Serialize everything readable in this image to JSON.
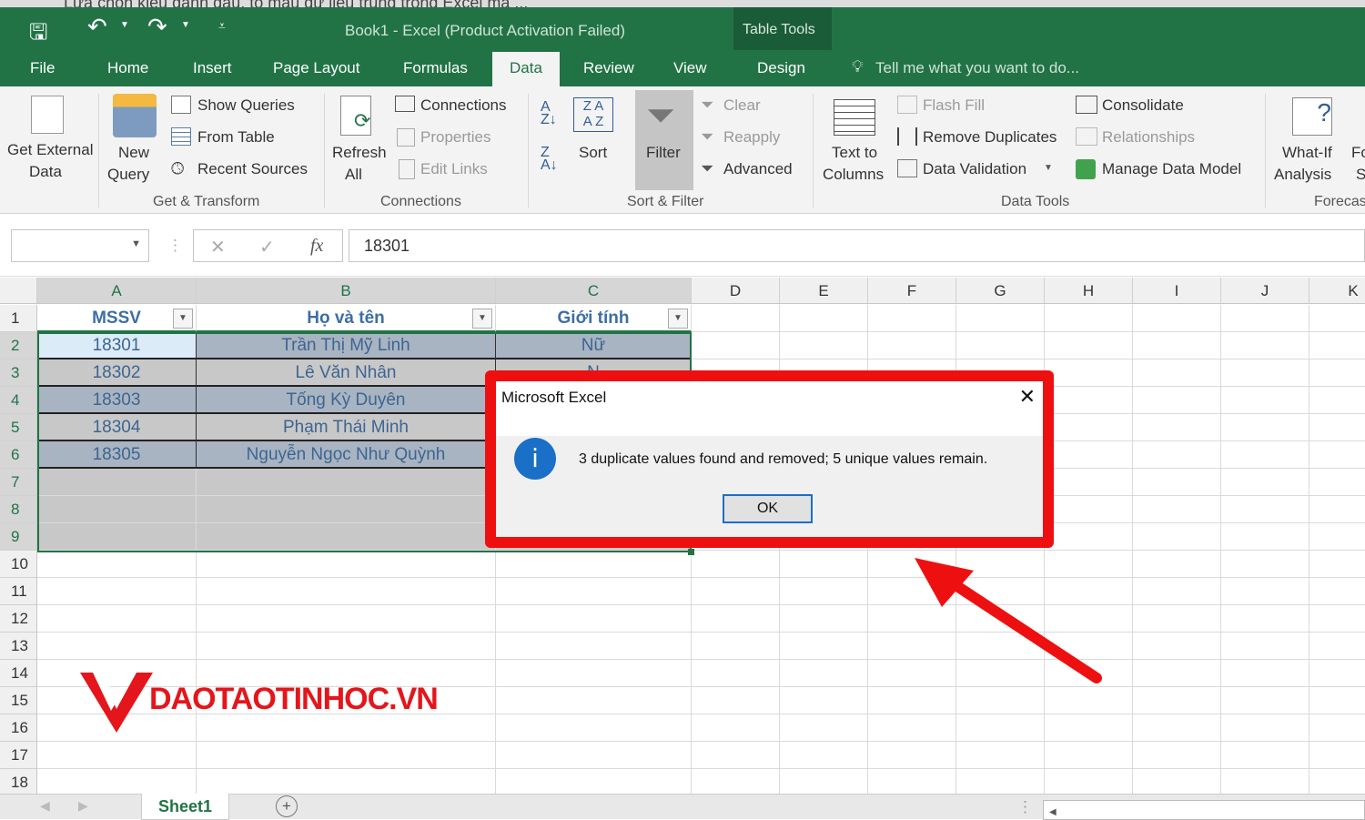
{
  "browser_tab_title": "Lựa chọn kiểu danh dấu, tô màu dữ liệu trùng trong Excel mà ...",
  "window": {
    "title": "Book1 - Excel (Product Activation Failed)",
    "context_tab": "Table Tools"
  },
  "tabs": [
    "File",
    "Home",
    "Insert",
    "Page Layout",
    "Formulas",
    "Data",
    "Review",
    "View",
    "Design"
  ],
  "active_tab": "Data",
  "tell_me": "Tell me what you want to do...",
  "ribbon": {
    "get_external_data": [
      "Get External",
      "Data"
    ],
    "new_query": [
      "New",
      "Query"
    ],
    "show_queries": "Show Queries",
    "from_table": "From Table",
    "recent_sources": "Recent Sources",
    "refresh_all": [
      "Refresh",
      "All"
    ],
    "connections": "Connections",
    "properties": "Properties",
    "edit_links": "Edit Links",
    "sort": "Sort",
    "filter": "Filter",
    "clear": "Clear",
    "reapply": "Reapply",
    "advanced": "Advanced",
    "text_to_columns": [
      "Text to",
      "Columns"
    ],
    "flash_fill": "Flash Fill",
    "remove_duplicates": "Remove Duplicates",
    "data_validation": "Data Validation",
    "consolidate": "Consolidate",
    "relationships": "Relationships",
    "manage_data_model": "Manage Data Model",
    "what_if": [
      "What-If",
      "Analysis"
    ],
    "forecast_cut": [
      "Fo",
      "S"
    ],
    "groups": [
      "Get & Transform",
      "Connections",
      "Sort & Filter",
      "Data Tools",
      "Forecas"
    ]
  },
  "formula_bar": {
    "name_box": "",
    "value": "18301",
    "fx": "fx"
  },
  "columns": [
    "A",
    "B",
    "C",
    "D",
    "E",
    "F",
    "G",
    "H",
    "I",
    "J",
    "K"
  ],
  "rows": [
    "1",
    "2",
    "3",
    "4",
    "5",
    "6",
    "7",
    "8",
    "9",
    "10",
    "11",
    "12",
    "13",
    "14",
    "15",
    "16",
    "17",
    "18"
  ],
  "table": {
    "headers": [
      "MSSV",
      "Họ và tên",
      "Giới tính"
    ],
    "rows": [
      [
        "18301",
        "Trần Thị Mỹ Linh",
        "Nữ"
      ],
      [
        "18302",
        "Lê Văn Nhân",
        "N"
      ],
      [
        "18303",
        "Tống Kỳ Duyên",
        ""
      ],
      [
        "18304",
        "Phạm Thái Minh",
        ""
      ],
      [
        "18305",
        "Nguyễn Ngọc Như Quỳnh",
        ""
      ]
    ]
  },
  "sheet_tabs": [
    "Sheet1"
  ],
  "dialog": {
    "title": "Microsoft Excel",
    "message": "3 duplicate values found and removed; 5 unique values remain.",
    "ok": "OK",
    "close": "✕"
  },
  "watermark": "DAOTAOTINHOC.VN",
  "colors": {
    "excel_green": "#217346",
    "highlight_red": "#ee1010"
  }
}
